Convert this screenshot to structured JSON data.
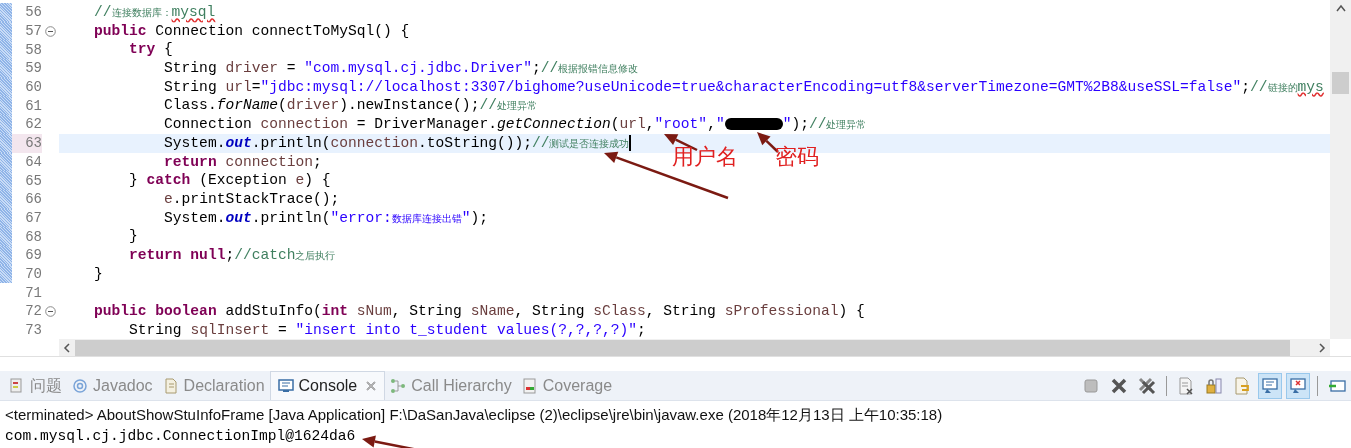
{
  "editor": {
    "lines": [
      {
        "number": "56",
        "changed": true,
        "current": false,
        "fold": false,
        "tokens": [
          {
            "kind": "comment",
            "text": "    //"
          },
          {
            "kind": "comment-cjk",
            "text": "连接数据库："
          },
          {
            "kind": "comment-misspelled",
            "text": "mysql"
          }
        ]
      },
      {
        "number": "57",
        "changed": true,
        "current": false,
        "fold": true,
        "tokens": [
          {
            "kind": "keyword",
            "text": "    public"
          },
          {
            "kind": "plain",
            "text": " Connection connectToMySql() {"
          }
        ]
      },
      {
        "number": "58",
        "changed": true,
        "current": false,
        "fold": false,
        "tokens": [
          {
            "kind": "keyword",
            "text": "        try"
          },
          {
            "kind": "plain",
            "text": " {"
          }
        ]
      },
      {
        "number": "59",
        "changed": true,
        "current": false,
        "fold": false,
        "tokens": [
          {
            "kind": "plain",
            "text": "            String "
          },
          {
            "kind": "variable",
            "text": "driver"
          },
          {
            "kind": "plain",
            "text": " = "
          },
          {
            "kind": "string",
            "text": "\"com.mysql.cj.jdbc.Driver\""
          },
          {
            "kind": "plain",
            "text": ";"
          },
          {
            "kind": "comment",
            "text": "//"
          },
          {
            "kind": "comment-cjk",
            "text": "根据报错信息修改"
          }
        ]
      },
      {
        "number": "60",
        "changed": true,
        "current": false,
        "fold": false,
        "tokens": [
          {
            "kind": "plain",
            "text": "            String "
          },
          {
            "kind": "variable",
            "text": "url"
          },
          {
            "kind": "plain",
            "text": "="
          },
          {
            "kind": "string",
            "text": "\"jdbc:mysql://localhost:3307/bighome?useUnicode=true&characterEncoding=utf8&serverTimezone=GMT%2B8&useSSL=false\""
          },
          {
            "kind": "plain",
            "text": ";"
          },
          {
            "kind": "comment",
            "text": "//"
          },
          {
            "kind": "comment-cjk",
            "text": "链接的"
          },
          {
            "kind": "comment-misspelled",
            "text": "mys"
          }
        ]
      },
      {
        "number": "61",
        "changed": true,
        "current": false,
        "fold": false,
        "tokens": [
          {
            "kind": "plain",
            "text": "            Class."
          },
          {
            "kind": "method",
            "text": "forName"
          },
          {
            "kind": "plain",
            "text": "("
          },
          {
            "kind": "variable",
            "text": "driver"
          },
          {
            "kind": "plain",
            "text": ").newInstance();"
          },
          {
            "kind": "comment",
            "text": "//"
          },
          {
            "kind": "comment-cjk",
            "text": "处理异常"
          }
        ]
      },
      {
        "number": "62",
        "changed": true,
        "current": false,
        "fold": false,
        "tokens": [
          {
            "kind": "plain",
            "text": "            Connection "
          },
          {
            "kind": "variable",
            "text": "connection"
          },
          {
            "kind": "plain",
            "text": " = DriverManager."
          },
          {
            "kind": "method",
            "text": "getConnection"
          },
          {
            "kind": "plain",
            "text": "("
          },
          {
            "kind": "variable",
            "text": "url"
          },
          {
            "kind": "plain",
            "text": ","
          },
          {
            "kind": "string",
            "text": "\"root\""
          },
          {
            "kind": "plain",
            "text": ","
          },
          {
            "kind": "string",
            "text": "\""
          },
          {
            "kind": "redacted"
          },
          {
            "kind": "string",
            "text": "\""
          },
          {
            "kind": "plain",
            "text": ");"
          },
          {
            "kind": "comment",
            "text": "//"
          },
          {
            "kind": "comment-cjk",
            "text": "处理异常"
          }
        ]
      },
      {
        "number": "63",
        "changed": true,
        "current": true,
        "fold": false,
        "tokens": [
          {
            "kind": "plain",
            "text": "            System."
          },
          {
            "kind": "static",
            "text": "out"
          },
          {
            "kind": "plain",
            "text": ".println("
          },
          {
            "kind": "variable",
            "text": "connection"
          },
          {
            "kind": "plain",
            "text": ".toString());"
          },
          {
            "kind": "comment",
            "text": "//"
          },
          {
            "kind": "comment-cjk",
            "text": "测试是否连接成功"
          },
          {
            "kind": "caret"
          }
        ]
      },
      {
        "number": "64",
        "changed": true,
        "current": false,
        "fold": false,
        "tokens": [
          {
            "kind": "keyword",
            "text": "            return"
          },
          {
            "kind": "variable",
            "text": " connection"
          },
          {
            "kind": "plain",
            "text": ";"
          }
        ]
      },
      {
        "number": "65",
        "changed": true,
        "current": false,
        "fold": false,
        "tokens": [
          {
            "kind": "plain",
            "text": "        } "
          },
          {
            "kind": "keyword",
            "text": "catch"
          },
          {
            "kind": "plain",
            "text": " (Exception "
          },
          {
            "kind": "variable",
            "text": "e"
          },
          {
            "kind": "plain",
            "text": ") {"
          }
        ]
      },
      {
        "number": "66",
        "changed": true,
        "current": false,
        "fold": false,
        "tokens": [
          {
            "kind": "variable",
            "text": "            e"
          },
          {
            "kind": "plain",
            "text": ".printStackTrace();"
          }
        ]
      },
      {
        "number": "67",
        "changed": true,
        "current": false,
        "fold": false,
        "tokens": [
          {
            "kind": "plain",
            "text": "            System."
          },
          {
            "kind": "static",
            "text": "out"
          },
          {
            "kind": "plain",
            "text": ".println("
          },
          {
            "kind": "string",
            "text": "\"error:"
          },
          {
            "kind": "string-cjk",
            "text": "数据库连接出错"
          },
          {
            "kind": "string",
            "text": "\""
          },
          {
            "kind": "plain",
            "text": ");"
          }
        ]
      },
      {
        "number": "68",
        "changed": true,
        "current": false,
        "fold": false,
        "tokens": [
          {
            "kind": "plain",
            "text": "        }"
          }
        ]
      },
      {
        "number": "69",
        "changed": true,
        "current": false,
        "fold": false,
        "tokens": [
          {
            "kind": "keyword",
            "text": "        return null"
          },
          {
            "kind": "plain",
            "text": ";"
          },
          {
            "kind": "comment",
            "text": "//catch"
          },
          {
            "kind": "comment-cjk",
            "text": "之后执行"
          }
        ]
      },
      {
        "number": "70",
        "changed": true,
        "current": false,
        "fold": false,
        "tokens": [
          {
            "kind": "plain",
            "text": "    }"
          }
        ]
      },
      {
        "number": "71",
        "changed": false,
        "current": false,
        "fold": false
      },
      {
        "number": "72",
        "changed": false,
        "current": false,
        "fold": true,
        "tokens": [
          {
            "kind": "keyword",
            "text": "    public boolean"
          },
          {
            "kind": "plain",
            "text": " addStuInfo("
          },
          {
            "kind": "keyword",
            "text": "int"
          },
          {
            "kind": "variable",
            "text": " sNum"
          },
          {
            "kind": "plain",
            "text": ", String "
          },
          {
            "kind": "variable",
            "text": "sName"
          },
          {
            "kind": "plain",
            "text": ", String "
          },
          {
            "kind": "variable",
            "text": "sClass"
          },
          {
            "kind": "plain",
            "text": ", String "
          },
          {
            "kind": "variable",
            "text": "sProfessional"
          },
          {
            "kind": "plain",
            "text": ") {"
          }
        ]
      },
      {
        "number": "73",
        "changed": false,
        "current": false,
        "fold": false,
        "tokens": [
          {
            "kind": "plain",
            "text": "        String "
          },
          {
            "kind": "variable",
            "text": "sqlInsert"
          },
          {
            "kind": "plain",
            "text": " = "
          },
          {
            "kind": "string",
            "text": "\"insert into t_student values(?,?,?,?)\""
          },
          {
            "kind": "plain",
            "text": ";"
          }
        ]
      }
    ]
  },
  "annotations": [
    {
      "kind": "username",
      "text": "用户名"
    },
    {
      "kind": "password",
      "text": "密码"
    }
  ],
  "panel": {
    "tabs": [
      {
        "kind": "problems",
        "label": "问题",
        "selected": false,
        "closable": false
      },
      {
        "kind": "javadoc",
        "label": "Javadoc",
        "selected": false,
        "closable": false
      },
      {
        "kind": "declaration",
        "label": "Declaration",
        "selected": false,
        "closable": false
      },
      {
        "kind": "console",
        "label": "Console",
        "selected": true,
        "closable": true
      },
      {
        "kind": "hierarchy",
        "label": "Call Hierarchy",
        "selected": false,
        "closable": false
      },
      {
        "kind": "coverage",
        "label": "Coverage",
        "selected": false,
        "closable": false
      }
    ],
    "toolbar": [
      {
        "kind": "stop",
        "selected": false
      },
      {
        "kind": "remove",
        "selected": false
      },
      {
        "kind": "remove-all",
        "selected": false
      },
      {
        "kind": "separator"
      },
      {
        "kind": "clear",
        "selected": false
      },
      {
        "kind": "scroll-lock",
        "selected": false
      },
      {
        "kind": "word-wrap",
        "selected": false
      },
      {
        "kind": "show-stdout",
        "selected": true
      },
      {
        "kind": "show-stderr",
        "selected": true
      },
      {
        "kind": "separator"
      },
      {
        "kind": "new-console",
        "selected": false
      }
    ],
    "console": {
      "header": "<terminated> AboutShowStuInfoFrame [Java Application] F:\\DaSanJava\\eclipse (2)\\eclipse\\jre\\bin\\javaw.exe (2018年12月13日 上午10:35:18)",
      "output": [
        "com.mysql.cj.jdbc.ConnectionImpl@1624da6"
      ]
    }
  }
}
